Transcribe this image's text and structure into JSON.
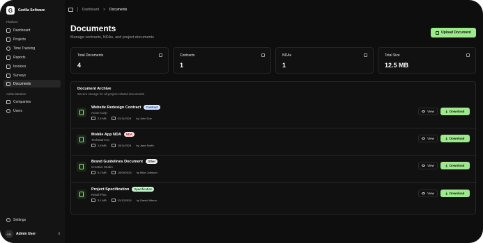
{
  "brand": {
    "logo_letter": "G",
    "name": "Gorilla Software"
  },
  "sidebar": {
    "platform_label": "Platform",
    "platform_items": [
      {
        "label": "Dashboard",
        "icon": "grid-icon"
      },
      {
        "label": "Projects",
        "icon": "folder-icon"
      },
      {
        "label": "Time Tracking",
        "icon": "clock-icon"
      },
      {
        "label": "Reports",
        "icon": "bar-chart-icon"
      },
      {
        "label": "Invoices",
        "icon": "receipt-icon"
      },
      {
        "label": "Surveys",
        "icon": "clipboard-icon"
      },
      {
        "label": "Documents",
        "icon": "document-icon",
        "active": true
      }
    ],
    "admin_label": "Administration",
    "admin_items": [
      {
        "label": "Companies",
        "icon": "building-icon"
      },
      {
        "label": "Users",
        "icon": "users-icon"
      }
    ],
    "settings_label": "Settings",
    "user": {
      "initials": "AU",
      "name": "Admin User"
    }
  },
  "breadcrumb": {
    "parent": "Dashboard",
    "separator": ">",
    "current": "Documents"
  },
  "page": {
    "title": "Documents",
    "subtitle": "Manage contracts, NDAs, and project documents",
    "upload_label": "Upload Document"
  },
  "stats": [
    {
      "label": "Total Documents",
      "value": "4"
    },
    {
      "label": "Contracts",
      "value": "1"
    },
    {
      "label": "NDAs",
      "value": "1"
    },
    {
      "label": "Total Size",
      "value": "12.5 MB"
    }
  ],
  "archive": {
    "title": "Document Archive",
    "subtitle": "Secure storage for all project-related documents",
    "view_label": "View",
    "download_label": "Download",
    "documents": [
      {
        "name": "Website Redesign Contract",
        "badge": "Contract",
        "company": "Acme Corp",
        "size": "2.4 MB",
        "date": "01/11/2024",
        "author": "by John Doe"
      },
      {
        "name": "Mobile App NDA",
        "badge": "NDA",
        "company": "TechStart Inc",
        "size": "1.8 MB",
        "date": "15/11/2024",
        "author": "by Jane Smith"
      },
      {
        "name": "Brand Guidelines Document",
        "badge": "Other",
        "company": "Creative Studio",
        "size": "5.2 MB",
        "date": "10/09/2024",
        "author": "by Mike Johnson"
      },
      {
        "name": "Project Specification",
        "badge": "Specification",
        "company": "Retail Plus",
        "size": "3.1 MB",
        "date": "01/12/2024",
        "author": "by Sarah Wilson"
      }
    ]
  },
  "colors": {
    "accent": "#9ee88d",
    "background": "#0e0e0e",
    "sidebar": "#141414"
  }
}
